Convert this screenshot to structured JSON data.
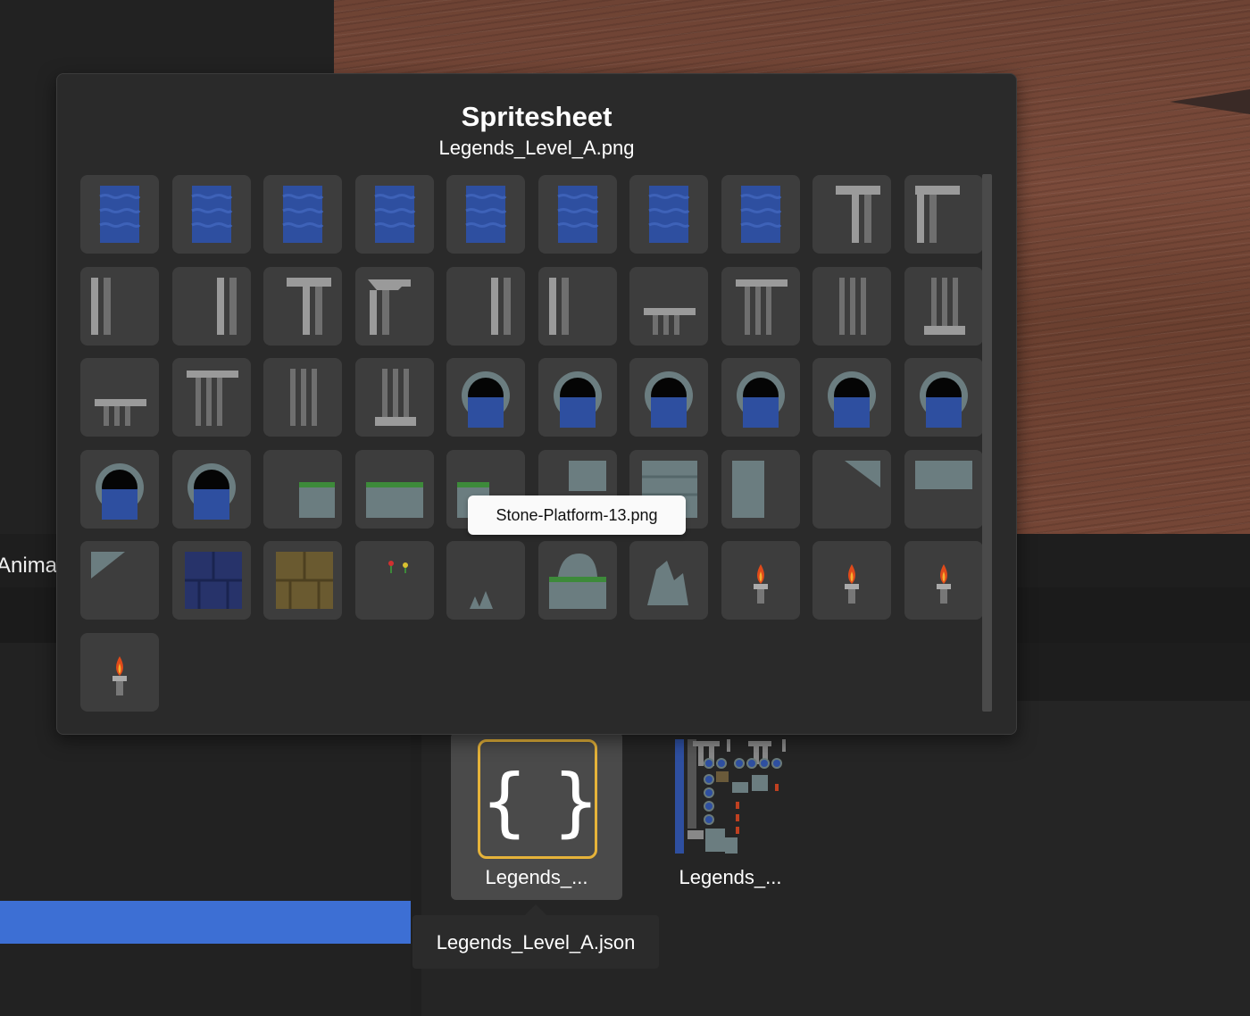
{
  "background": {
    "left_panel_label": "Anima"
  },
  "spritesheet_popup": {
    "title": "Spritesheet",
    "filename": "Legends_Level_A.png",
    "tiles": [
      {
        "kind": "water"
      },
      {
        "kind": "water"
      },
      {
        "kind": "water"
      },
      {
        "kind": "water"
      },
      {
        "kind": "water"
      },
      {
        "kind": "water"
      },
      {
        "kind": "water"
      },
      {
        "kind": "water"
      },
      {
        "kind": "pillar-top-t"
      },
      {
        "kind": "pillar-top-t-left"
      },
      {
        "kind": "pillar-shaft-left"
      },
      {
        "kind": "pillar-shaft-right"
      },
      {
        "kind": "pillar-top-t"
      },
      {
        "kind": "pillar-top-broken"
      },
      {
        "kind": "pillar-shaft-right"
      },
      {
        "kind": "pillar-shaft-left"
      },
      {
        "kind": "column-capital-small"
      },
      {
        "kind": "column-capital"
      },
      {
        "kind": "column-shaft-dark"
      },
      {
        "kind": "column-base-dark"
      },
      {
        "kind": "column-capital-small"
      },
      {
        "kind": "column-capital"
      },
      {
        "kind": "column-shaft-dark"
      },
      {
        "kind": "column-base-dark"
      },
      {
        "kind": "pipe-water"
      },
      {
        "kind": "pipe-water"
      },
      {
        "kind": "pipe-water"
      },
      {
        "kind": "pipe-water"
      },
      {
        "kind": "pipe-water"
      },
      {
        "kind": "pipe-water"
      },
      {
        "kind": "pipe-water"
      },
      {
        "kind": "pipe-water"
      },
      {
        "kind": "stone-platform-small"
      },
      {
        "kind": "stone-platform"
      },
      {
        "kind": "stone-platform-partial"
      },
      {
        "kind": "stone-wall-partial"
      },
      {
        "kind": "stone-wall"
      },
      {
        "kind": "stone-wall-left"
      },
      {
        "kind": "stone-corner"
      },
      {
        "kind": "stone-wall-top"
      },
      {
        "kind": "stone-corner-small"
      },
      {
        "kind": "brick-blue"
      },
      {
        "kind": "brick-brown"
      },
      {
        "kind": "flowers"
      },
      {
        "kind": "rocks-small"
      },
      {
        "kind": "rock-on-grass"
      },
      {
        "kind": "rock-large"
      },
      {
        "kind": "torch"
      },
      {
        "kind": "torch"
      },
      {
        "kind": "torch"
      },
      {
        "kind": "torch"
      }
    ],
    "hover_tooltip": "Stone-Platform-13.png"
  },
  "asset_browser": {
    "items": [
      {
        "label": "Legends_...",
        "icon": "json-braces-icon",
        "glyph": "{ }",
        "selected": true
      },
      {
        "label": "Legends_...",
        "icon": "spritesheet-thumbnail",
        "selected": false
      }
    ],
    "selected_tooltip": "Legends_Level_A.json"
  },
  "colors": {
    "selection_border": "#e6b33a",
    "highlight_bar": "#3d6fd4",
    "water": "#2e4fa0"
  }
}
